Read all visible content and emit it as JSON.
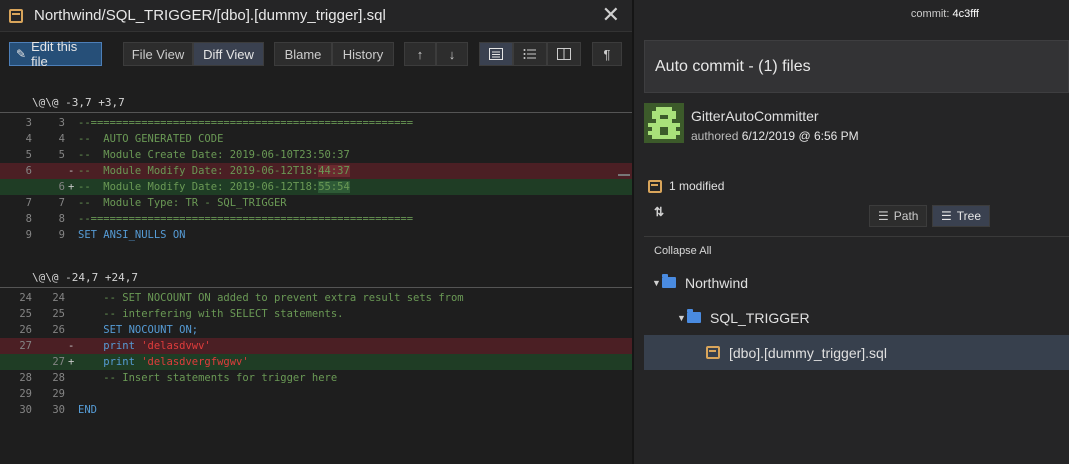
{
  "editor": {
    "file_title": "Northwind/SQL_TRIGGER/[dbo].[dummy_trigger].sql",
    "close_glyph": "✕",
    "toolbar": {
      "edit_label": "Edit this file",
      "file_view_label": "File View",
      "diff_view_label": "Diff View",
      "blame_label": "Blame",
      "history_label": "History",
      "up_glyph": "↑",
      "down_glyph": "↓",
      "pilcrow_glyph": "¶"
    },
    "hunks": [
      {
        "header": "\\@\\@ -3,7 +3,7",
        "rows": [
          {
            "o": "3",
            "n": "3",
            "mk": "",
            "type": "ctx",
            "text": "--==================================================="
          },
          {
            "o": "4",
            "n": "4",
            "mk": "",
            "type": "ctx",
            "text": "--  AUTO GENERATED CODE"
          },
          {
            "o": "5",
            "n": "5",
            "mk": "",
            "type": "ctx",
            "text": "--  Module Create Date: 2019-06-10T23:50:37"
          },
          {
            "o": "6",
            "n": "",
            "mk": "-",
            "type": "del",
            "text": "--  Module Modify Date: 2019-06-12T18:",
            "hl": "44:37"
          },
          {
            "o": "",
            "n": "6",
            "mk": "+",
            "type": "add",
            "text": "--  Module Modify Date: 2019-06-12T18:",
            "hl": "55:54"
          },
          {
            "o": "7",
            "n": "7",
            "mk": "",
            "type": "ctx",
            "text": "--  Module Type: TR - SQL_TRIGGER"
          },
          {
            "o": "8",
            "n": "8",
            "mk": "",
            "type": "ctx",
            "text": "--==================================================="
          },
          {
            "o": "9",
            "n": "9",
            "mk": "",
            "type": "kw",
            "text": "SET ANSI_NULLS ON"
          }
        ]
      },
      {
        "header": "\\@\\@ -24,7 +24,7",
        "rows": [
          {
            "o": "24",
            "n": "24",
            "mk": "",
            "type": "ctx",
            "text": "    -- SET NOCOUNT ON added to prevent extra result sets from"
          },
          {
            "o": "25",
            "n": "25",
            "mk": "",
            "type": "ctx",
            "text": "    -- interfering with SELECT statements."
          },
          {
            "o": "26",
            "n": "26",
            "mk": "",
            "type": "kw",
            "text": "    SET NOCOUNT ON;"
          },
          {
            "o": "27",
            "n": "",
            "mk": "-",
            "type": "del-print",
            "text": "    print ",
            "str": "'delasdvwv'"
          },
          {
            "o": "",
            "n": "27",
            "mk": "+",
            "type": "add-print",
            "text": "    print ",
            "str": "'delasdvergfwgwv'"
          },
          {
            "o": "28",
            "n": "28",
            "mk": "",
            "type": "ctx",
            "text": "    -- Insert statements for trigger here"
          },
          {
            "o": "29",
            "n": "29",
            "mk": "",
            "type": "ctx",
            "text": ""
          },
          {
            "o": "30",
            "n": "30",
            "mk": "",
            "type": "kw",
            "text": "END"
          }
        ]
      }
    ]
  },
  "commit": {
    "id_label": "commit:",
    "id_value": "4c3fff",
    "message": "Auto commit - (1) files",
    "author": "GitterAutoCommitter",
    "authored_label": "authored",
    "authored_date": "6/12/2019 @ 6:56 PM",
    "modified_count": "1 modified",
    "sort_glyph": "⇅",
    "view_path_label": "Path",
    "view_tree_label": "Tree",
    "collapse_all_label": "Collapse All",
    "tree": [
      {
        "label": "Northwind",
        "kind": "folder"
      },
      {
        "label": "SQL_TRIGGER",
        "kind": "folder"
      },
      {
        "label": "[dbo].[dummy_trigger].sql",
        "kind": "file"
      }
    ]
  },
  "colors": {
    "accent": "#264f78",
    "deleted_row": "#4b1f24",
    "added_row": "#1f3d25",
    "folder_blue": "#4a8be0",
    "file_orange": "#d9a55b"
  }
}
